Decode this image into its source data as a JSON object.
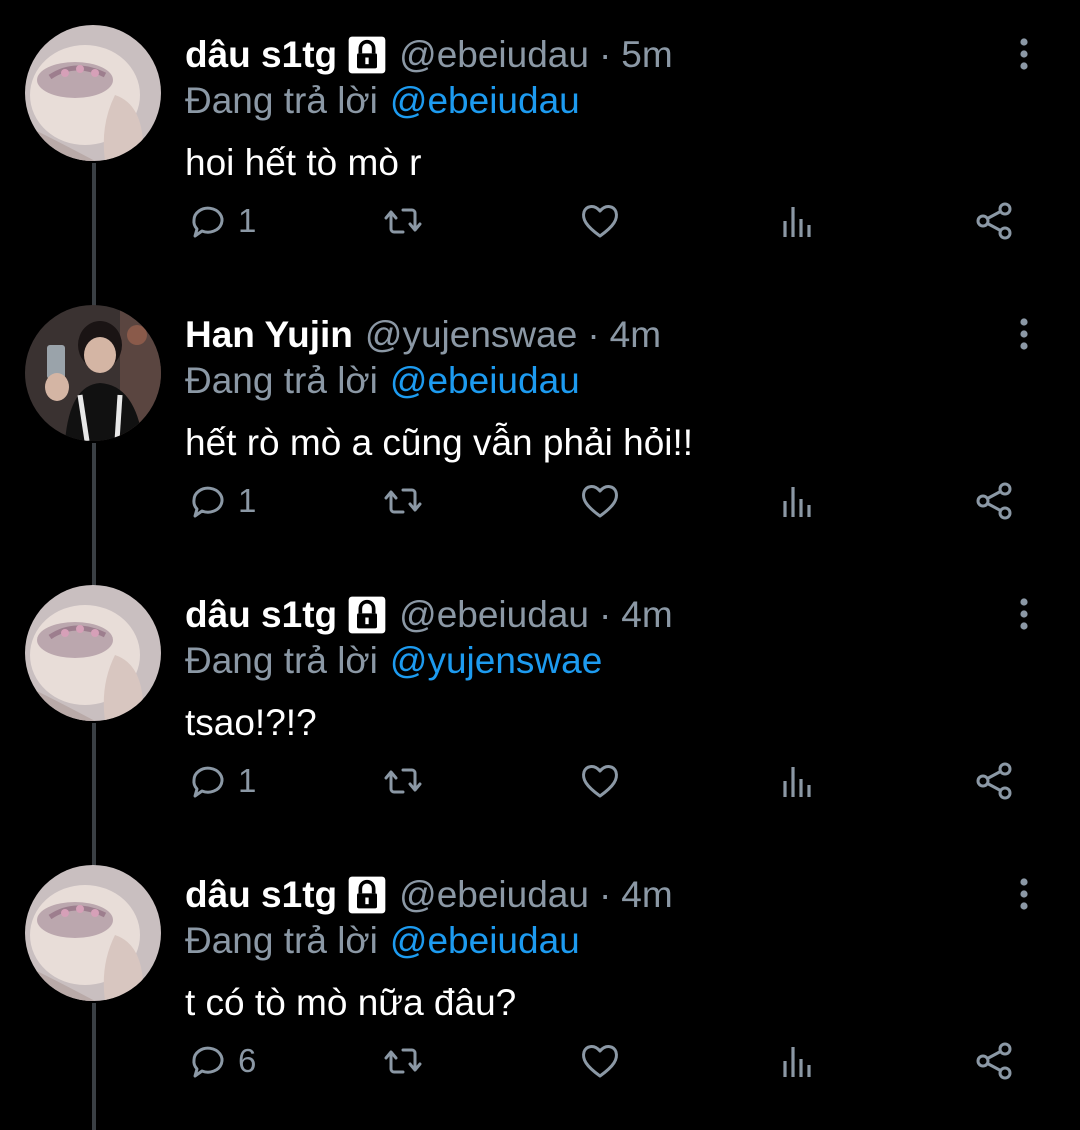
{
  "colors": {
    "background": "#000000",
    "name": "#ffffff",
    "secondary": "#8b98a5",
    "mention": "#1d9bf0",
    "thread_line": "#3a3f44"
  },
  "tweets": [
    {
      "name": "dâu s1tg",
      "protected": true,
      "handle": "@ebeiudau",
      "separator": "·",
      "time": "5m",
      "reply_label": "Đang trả lời",
      "reply_to": "@ebeiudau",
      "text": "hoi hết tò mò r",
      "reply_count": "1",
      "avatar_icon": "avatar-strawberry-icon"
    },
    {
      "name": "Han Yujin",
      "protected": false,
      "handle": "@yujenswae",
      "separator": "·",
      "time": "4m",
      "reply_label": "Đang trả lời",
      "reply_to": "@ebeiudau",
      "text": "hết rò mò a cũng vẫn phải hỏi!!",
      "reply_count": "1",
      "avatar_icon": "avatar-selfie-icon"
    },
    {
      "name": "dâu s1tg",
      "protected": true,
      "handle": "@ebeiudau",
      "separator": "·",
      "time": "4m",
      "reply_label": "Đang trả lời",
      "reply_to": "@yujenswae",
      "text": "tsao!?!?",
      "reply_count": "1",
      "avatar_icon": "avatar-strawberry-icon"
    },
    {
      "name": "dâu s1tg",
      "protected": true,
      "handle": "@ebeiudau",
      "separator": "·",
      "time": "4m",
      "reply_label": "Đang trả lời",
      "reply_to": "@ebeiudau",
      "text": "t có tò mò nữa đâu?",
      "reply_count": "6",
      "avatar_icon": "avatar-strawberry-icon"
    }
  ]
}
